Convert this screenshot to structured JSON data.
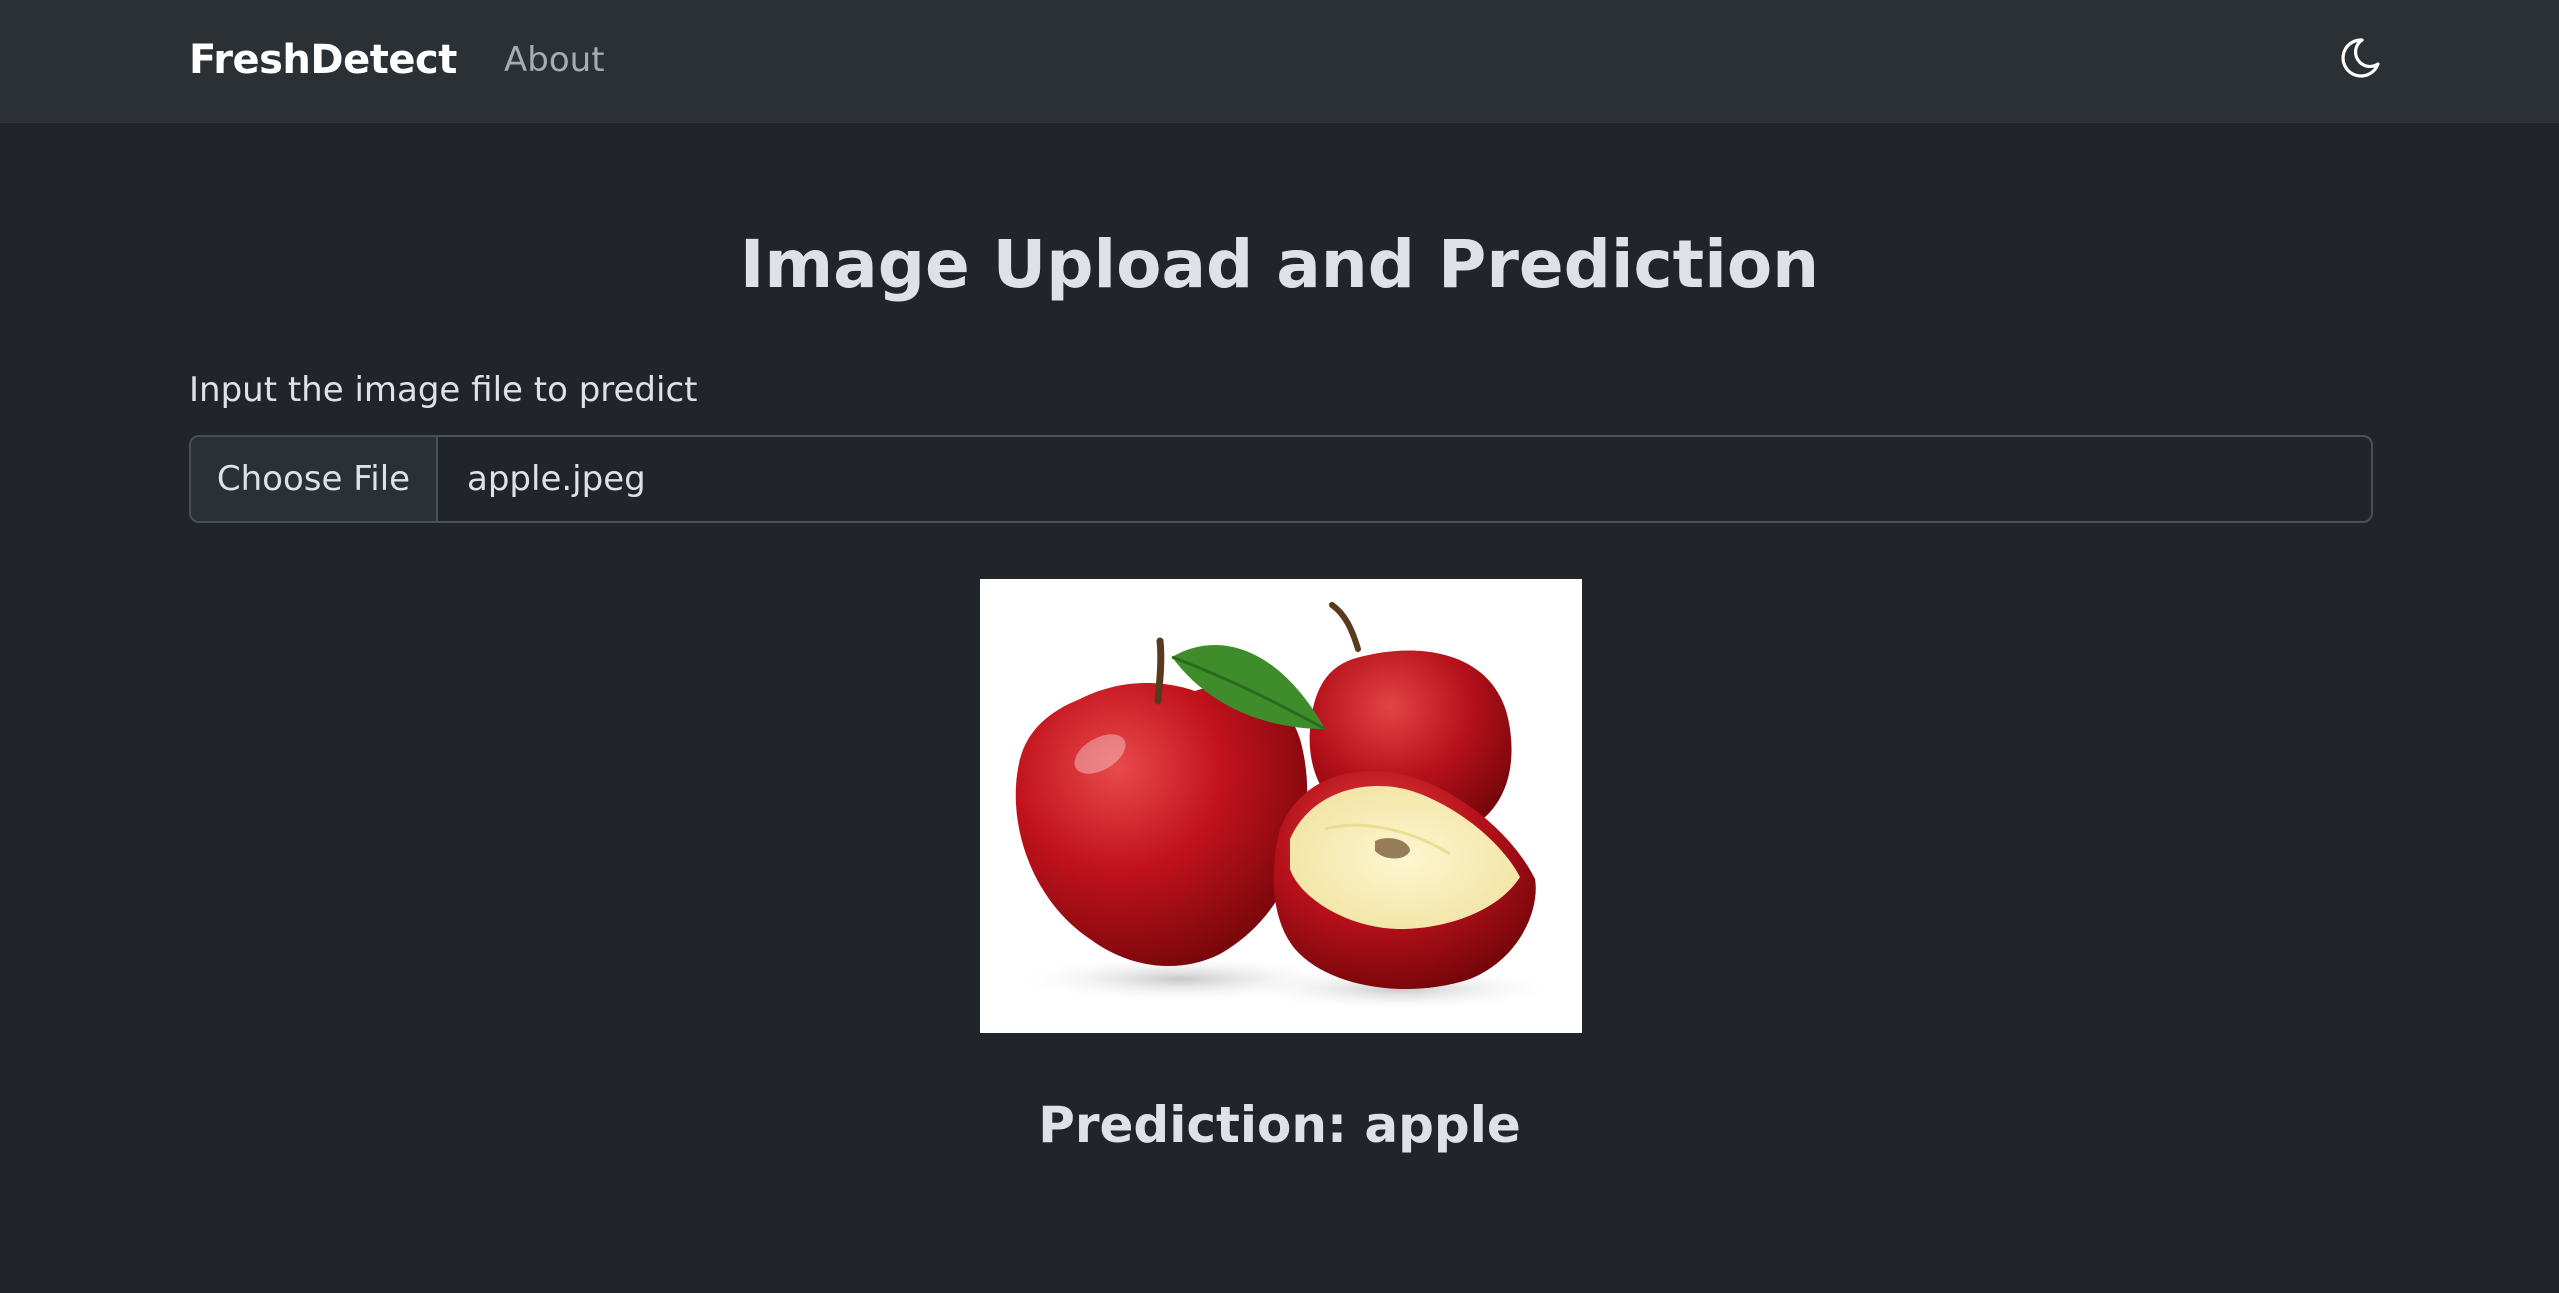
{
  "navbar": {
    "brand": "FreshDetect",
    "about_label": "About",
    "theme_icon": "moon-icon"
  },
  "main": {
    "title": "Image Upload and Prediction",
    "input_label": "Input the image file to predict",
    "file_button_label": "Choose File",
    "file_name": "apple.jpeg",
    "preview_image": "apple-photo",
    "prediction_prefix": "Prediction: ",
    "prediction_value": "apple"
  },
  "colors": {
    "page_bg": "#212529",
    "navbar_bg": "#2b3035",
    "text": "#dee2e6",
    "muted": "#a7acb1"
  }
}
